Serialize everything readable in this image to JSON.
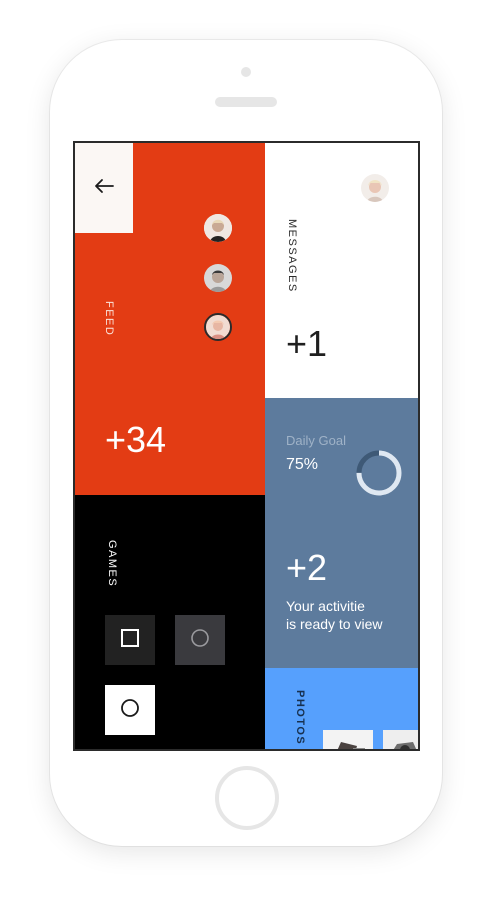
{
  "feed": {
    "label": "FEED",
    "count": "+34",
    "color": "#e33c14",
    "avatars": [
      "avatar-user-1",
      "avatar-user-2",
      "avatar-user-3"
    ]
  },
  "messages": {
    "label": "MESSAGES",
    "count": "+1"
  },
  "daily_goal": {
    "title": "Daily Goal",
    "percent_text": "75%",
    "progress": 0.75,
    "count": "+2",
    "line1": "Your activitie",
    "line2": "is ready to view",
    "color": "#5d7b9d"
  },
  "games": {
    "label": "GAMES",
    "buttons": [
      "square-icon",
      "circle-icon",
      "circle-icon"
    ]
  },
  "photos": {
    "label": "PHOTOS",
    "color": "#56a0fd"
  },
  "icons": {
    "back": "arrow-left-icon"
  }
}
